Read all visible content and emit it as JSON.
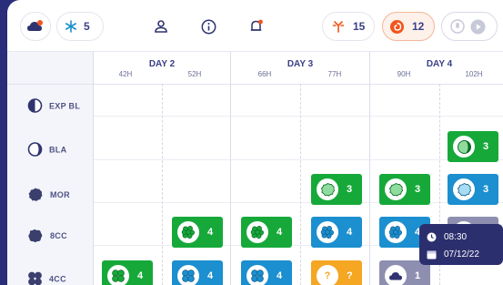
{
  "topbar": {
    "cells_count": "5",
    "antenna_count": "15",
    "spiral_count": "12"
  },
  "days": [
    {
      "label": "DAY 2",
      "hours": [
        "42H",
        "52H"
      ]
    },
    {
      "label": "DAY 3",
      "hours": [
        "66H",
        "77H"
      ]
    },
    {
      "label": "DAY 4",
      "hours": [
        "90H",
        "102H"
      ]
    }
  ],
  "rows": [
    {
      "label": "EXP BL",
      "icon": "half-circle-icon"
    },
    {
      "label": "BLA",
      "icon": "blastocyst-icon"
    },
    {
      "label": "MOR",
      "icon": "morula-icon"
    },
    {
      "label": "8CC",
      "icon": "eight-cell-icon"
    },
    {
      "label": "4CC",
      "icon": "four-cell-icon"
    }
  ],
  "cards": [
    {
      "value": "4",
      "color": "#16a93a",
      "icon": "four-cell-icon"
    },
    {
      "value": "4",
      "color": "#16a93a",
      "icon": "eight-cell-icon"
    },
    {
      "value": "4",
      "color": "#1b8fcf",
      "icon": "four-cell-icon"
    },
    {
      "value": "4",
      "color": "#16a93a",
      "icon": "eight-cell-icon"
    },
    {
      "value": "4",
      "color": "#1b8fcf",
      "icon": "four-cell-icon"
    },
    {
      "value": "3",
      "color": "#16a93a",
      "icon": "morula-icon"
    },
    {
      "value": "4",
      "color": "#1b8fcf",
      "icon": "eight-cell-icon"
    },
    {
      "value": "?",
      "color": "#f5a623",
      "icon": "unknown-icon"
    },
    {
      "value": "3",
      "color": "#16a93a",
      "icon": "morula-icon"
    },
    {
      "value": "4",
      "color": "#1b8fcf",
      "icon": "eight-cell-icon"
    },
    {
      "value": "1",
      "color": "#8e8fb0",
      "icon": "cloud-icon"
    },
    {
      "value": "3",
      "color": "#16a93a",
      "icon": "blastocyst-icon"
    },
    {
      "value": "3",
      "color": "#1b8fcf",
      "icon": "morula-icon"
    },
    {
      "value": "",
      "color": "#8e8fb0",
      "icon": "blank-icon"
    }
  ],
  "tooltip": {
    "time": "08:30",
    "date": "07/12/22"
  },
  "colors": {
    "green": "#16a93a",
    "blue": "#1b8fcf",
    "orange": "#f5a623",
    "gray": "#8e8fb0",
    "navy": "#3a3f86"
  }
}
